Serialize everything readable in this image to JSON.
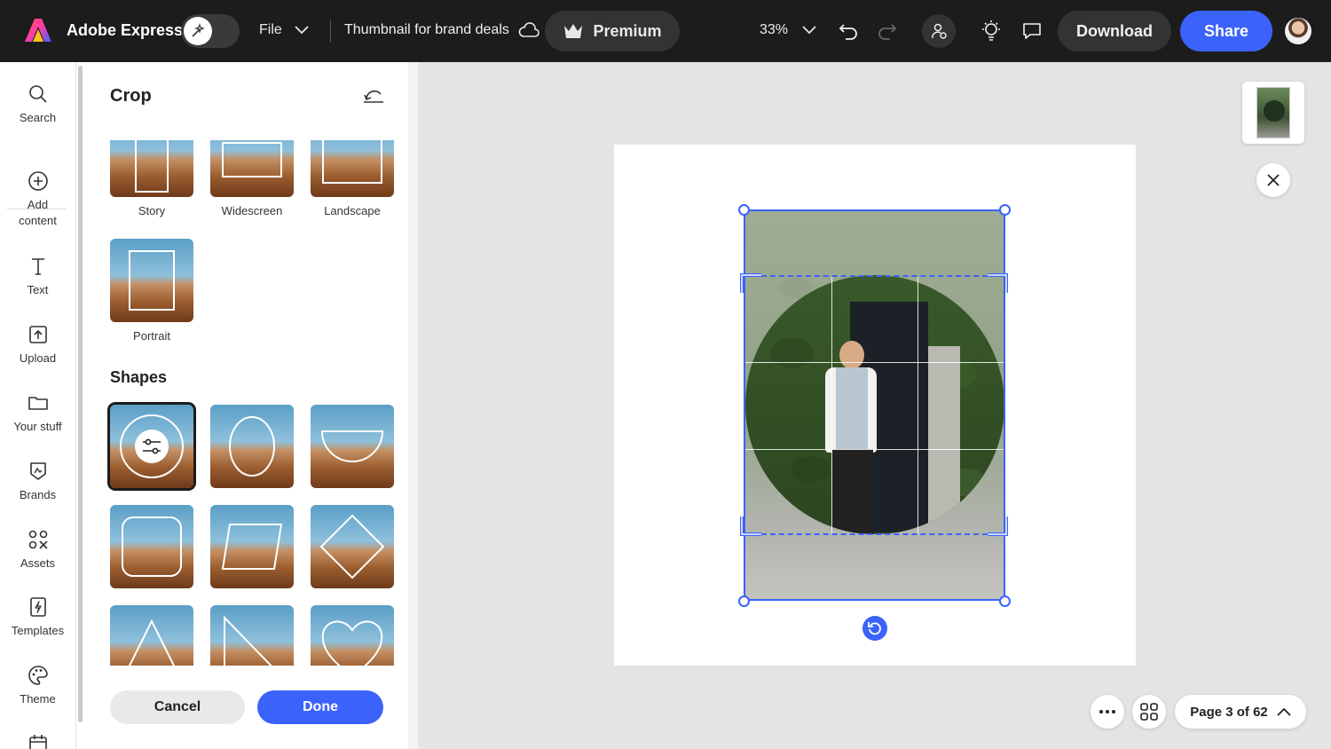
{
  "topbar": {
    "app_name": "Adobe Express",
    "file_label": "File",
    "doc_title": "Thumbnail for brand deals",
    "premium_label": "Premium",
    "zoom": "33%",
    "download_label": "Download",
    "share_label": "Share",
    "accent_color": "#3b63fb"
  },
  "rail": {
    "items": [
      {
        "label": "Search",
        "icon": "search-icon"
      },
      {
        "label": "Add content",
        "icon": "plus-circle-icon"
      },
      {
        "label": "Text",
        "icon": "text-icon"
      },
      {
        "label": "Upload",
        "icon": "upload-icon"
      },
      {
        "label": "Your stuff",
        "icon": "folder-icon"
      },
      {
        "label": "Brands",
        "icon": "brand-icon"
      },
      {
        "label": "Assets",
        "icon": "assets-icon"
      },
      {
        "label": "Templates",
        "icon": "templates-icon"
      },
      {
        "label": "Theme",
        "icon": "palette-icon"
      }
    ]
  },
  "panel": {
    "title": "Crop",
    "ratios": [
      "Story",
      "Widescreen",
      "Landscape",
      "Portrait"
    ],
    "shapes_title": "Shapes",
    "shapes": [
      "circle",
      "ellipse",
      "half-circle",
      "rounded-square",
      "parallelogram",
      "diamond",
      "triangle",
      "right-triangle",
      "heart"
    ],
    "cancel_label": "Cancel",
    "done_label": "Done"
  },
  "footer": {
    "page_indicator": "Page 3 of 62"
  }
}
